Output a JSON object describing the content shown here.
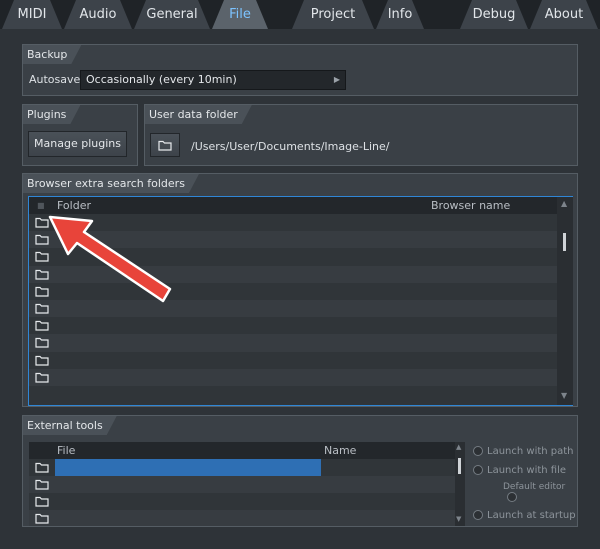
{
  "tabs": [
    {
      "id": "midi",
      "label": "MIDI"
    },
    {
      "id": "audio",
      "label": "Audio"
    },
    {
      "id": "general",
      "label": "General"
    },
    {
      "id": "file",
      "label": "File",
      "active": true
    },
    {
      "id": "project",
      "label": "Project"
    },
    {
      "id": "info",
      "label": "Info"
    },
    {
      "id": "debug",
      "label": "Debug"
    },
    {
      "id": "about",
      "label": "About"
    }
  ],
  "backup": {
    "title": "Backup",
    "autosave_label": "Autosave",
    "autosave_value": "Occasionally (every 10min)"
  },
  "plugins": {
    "title": "Plugins",
    "manage_label": "Manage plugins"
  },
  "user_data": {
    "title": "User data folder",
    "path": "/Users/User/Documents/Image-Line/"
  },
  "browser_folders": {
    "title": "Browser extra search folders",
    "col_folder": "Folder",
    "col_browser_name": "Browser name",
    "row_count": 10
  },
  "external_tools": {
    "title": "External tools",
    "col_file": "File",
    "col_name": "Name",
    "row_count": 4,
    "options": {
      "launch_with_path": "Launch with path",
      "launch_with_file": "Launch with file",
      "default_editor": "Default editor",
      "launch_at_startup": "Launch at startup"
    }
  },
  "colors": {
    "accent": "#7cc3ff",
    "selection": "#2e6fb4",
    "annotation_arrow": "#e8443a"
  },
  "icons": [
    "folder-icon",
    "arrow-annotation"
  ]
}
